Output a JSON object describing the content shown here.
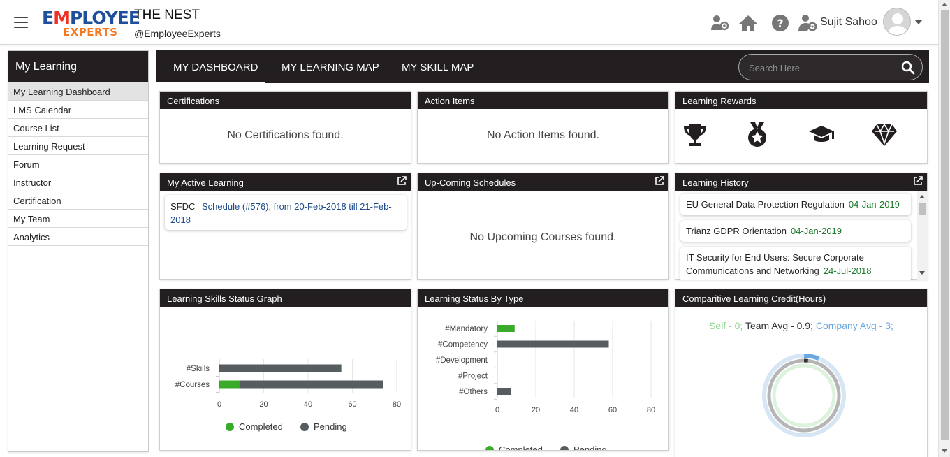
{
  "header": {
    "logo": {
      "line1_a": "E",
      "line1_b": "M",
      "line1_c": "PLOYEE",
      "line2": "EXPERTS"
    },
    "org_name": "THE NEST",
    "org_handle": "@EmployeeExperts",
    "icons": [
      "people-settings-icon",
      "home-icon",
      "help-icon",
      "admin-settings-icon"
    ],
    "user_name": "Sujit Sahoo"
  },
  "sidebar": {
    "title": "My Learning",
    "items": [
      {
        "label": "My Learning Dashboard",
        "active": true
      },
      {
        "label": "LMS Calendar"
      },
      {
        "label": "Course List"
      },
      {
        "label": "Learning Request"
      },
      {
        "label": "Forum"
      },
      {
        "label": "Instructor"
      },
      {
        "label": "Certification"
      },
      {
        "label": "My Team"
      },
      {
        "label": "Analytics"
      }
    ]
  },
  "topnav": {
    "tabs": [
      {
        "label": "MY DASHBOARD",
        "active": true
      },
      {
        "label": "MY LEARNING MAP"
      },
      {
        "label": "MY SKILL MAP"
      }
    ],
    "search_placeholder": "Search Here"
  },
  "cards": {
    "certifications": {
      "title": "Certifications",
      "empty": "No Certifications found."
    },
    "action_items": {
      "title": "Action Items",
      "empty": "No Action Items found."
    },
    "learning_rewards": {
      "title": "Learning Rewards",
      "icons": [
        "trophy-icon",
        "medal-icon",
        "graduation-cap-icon",
        "diamond-icon"
      ]
    },
    "active_learning": {
      "title": "My Active Learning",
      "items": [
        {
          "course": "SFDC",
          "schedule": "Schedule (#576), from 20-Feb-2018 till 21-Feb-2018"
        }
      ]
    },
    "upcoming": {
      "title": "Up-Coming Schedules",
      "empty": "No Upcoming Courses found."
    },
    "history": {
      "title": "Learning History",
      "items": [
        {
          "name": "EU General Data Protection Regulation",
          "date": "04-Jan-2019"
        },
        {
          "name": "Trianz GDPR Orientation",
          "date": "04-Jan-2019"
        },
        {
          "name": "IT Security for End Users: Secure Corporate Communications and Networking",
          "date": "24-Jul-2018"
        }
      ]
    },
    "skills_graph": {
      "title": "Learning Skills Status Graph"
    },
    "status_by_type": {
      "title": "Learning Status By Type"
    },
    "credit": {
      "title": "Comparitive Learning Credit(Hours)",
      "self": "Self - 0;",
      "team": "Team Avg - 0.9;",
      "company": "Company Avg - 3;",
      "self_value": 0,
      "team_value": 0.9,
      "company_value": 3
    }
  },
  "colors": {
    "completed": "#3aaa2a",
    "pending": "#555d60",
    "header_dark": "#231f20",
    "self": "#8fd38f",
    "company": "#6aa7df"
  },
  "chart_data": [
    {
      "type": "bar",
      "orientation": "horizontal",
      "stacked": true,
      "categories": [
        "#Skills",
        "#Courses"
      ],
      "series": [
        {
          "name": "Completed",
          "values": [
            0,
            9
          ]
        },
        {
          "name": "Pending",
          "values": [
            55,
            65
          ]
        }
      ],
      "xlim": [
        0,
        80
      ],
      "ticks": [
        0,
        20,
        40,
        60,
        80
      ],
      "legend": "bottom"
    },
    {
      "type": "bar",
      "orientation": "horizontal",
      "stacked": true,
      "categories": [
        "#Mandatory",
        "#Competency",
        "#Development",
        "#Project",
        "#Others"
      ],
      "series": [
        {
          "name": "Completed",
          "values": [
            9,
            0,
            0,
            0,
            0
          ]
        },
        {
          "name": "Pending",
          "values": [
            0,
            58,
            0,
            0,
            7
          ]
        }
      ],
      "xlim": [
        0,
        80
      ],
      "ticks": [
        0,
        20,
        40,
        60,
        80
      ],
      "legend": "bottom"
    },
    {
      "type": "pie",
      "subtype": "radial-progress",
      "series": [
        {
          "name": "Self",
          "value": 0
        },
        {
          "name": "Team Avg",
          "value": 0.9
        },
        {
          "name": "Company Avg",
          "value": 3
        }
      ]
    }
  ]
}
